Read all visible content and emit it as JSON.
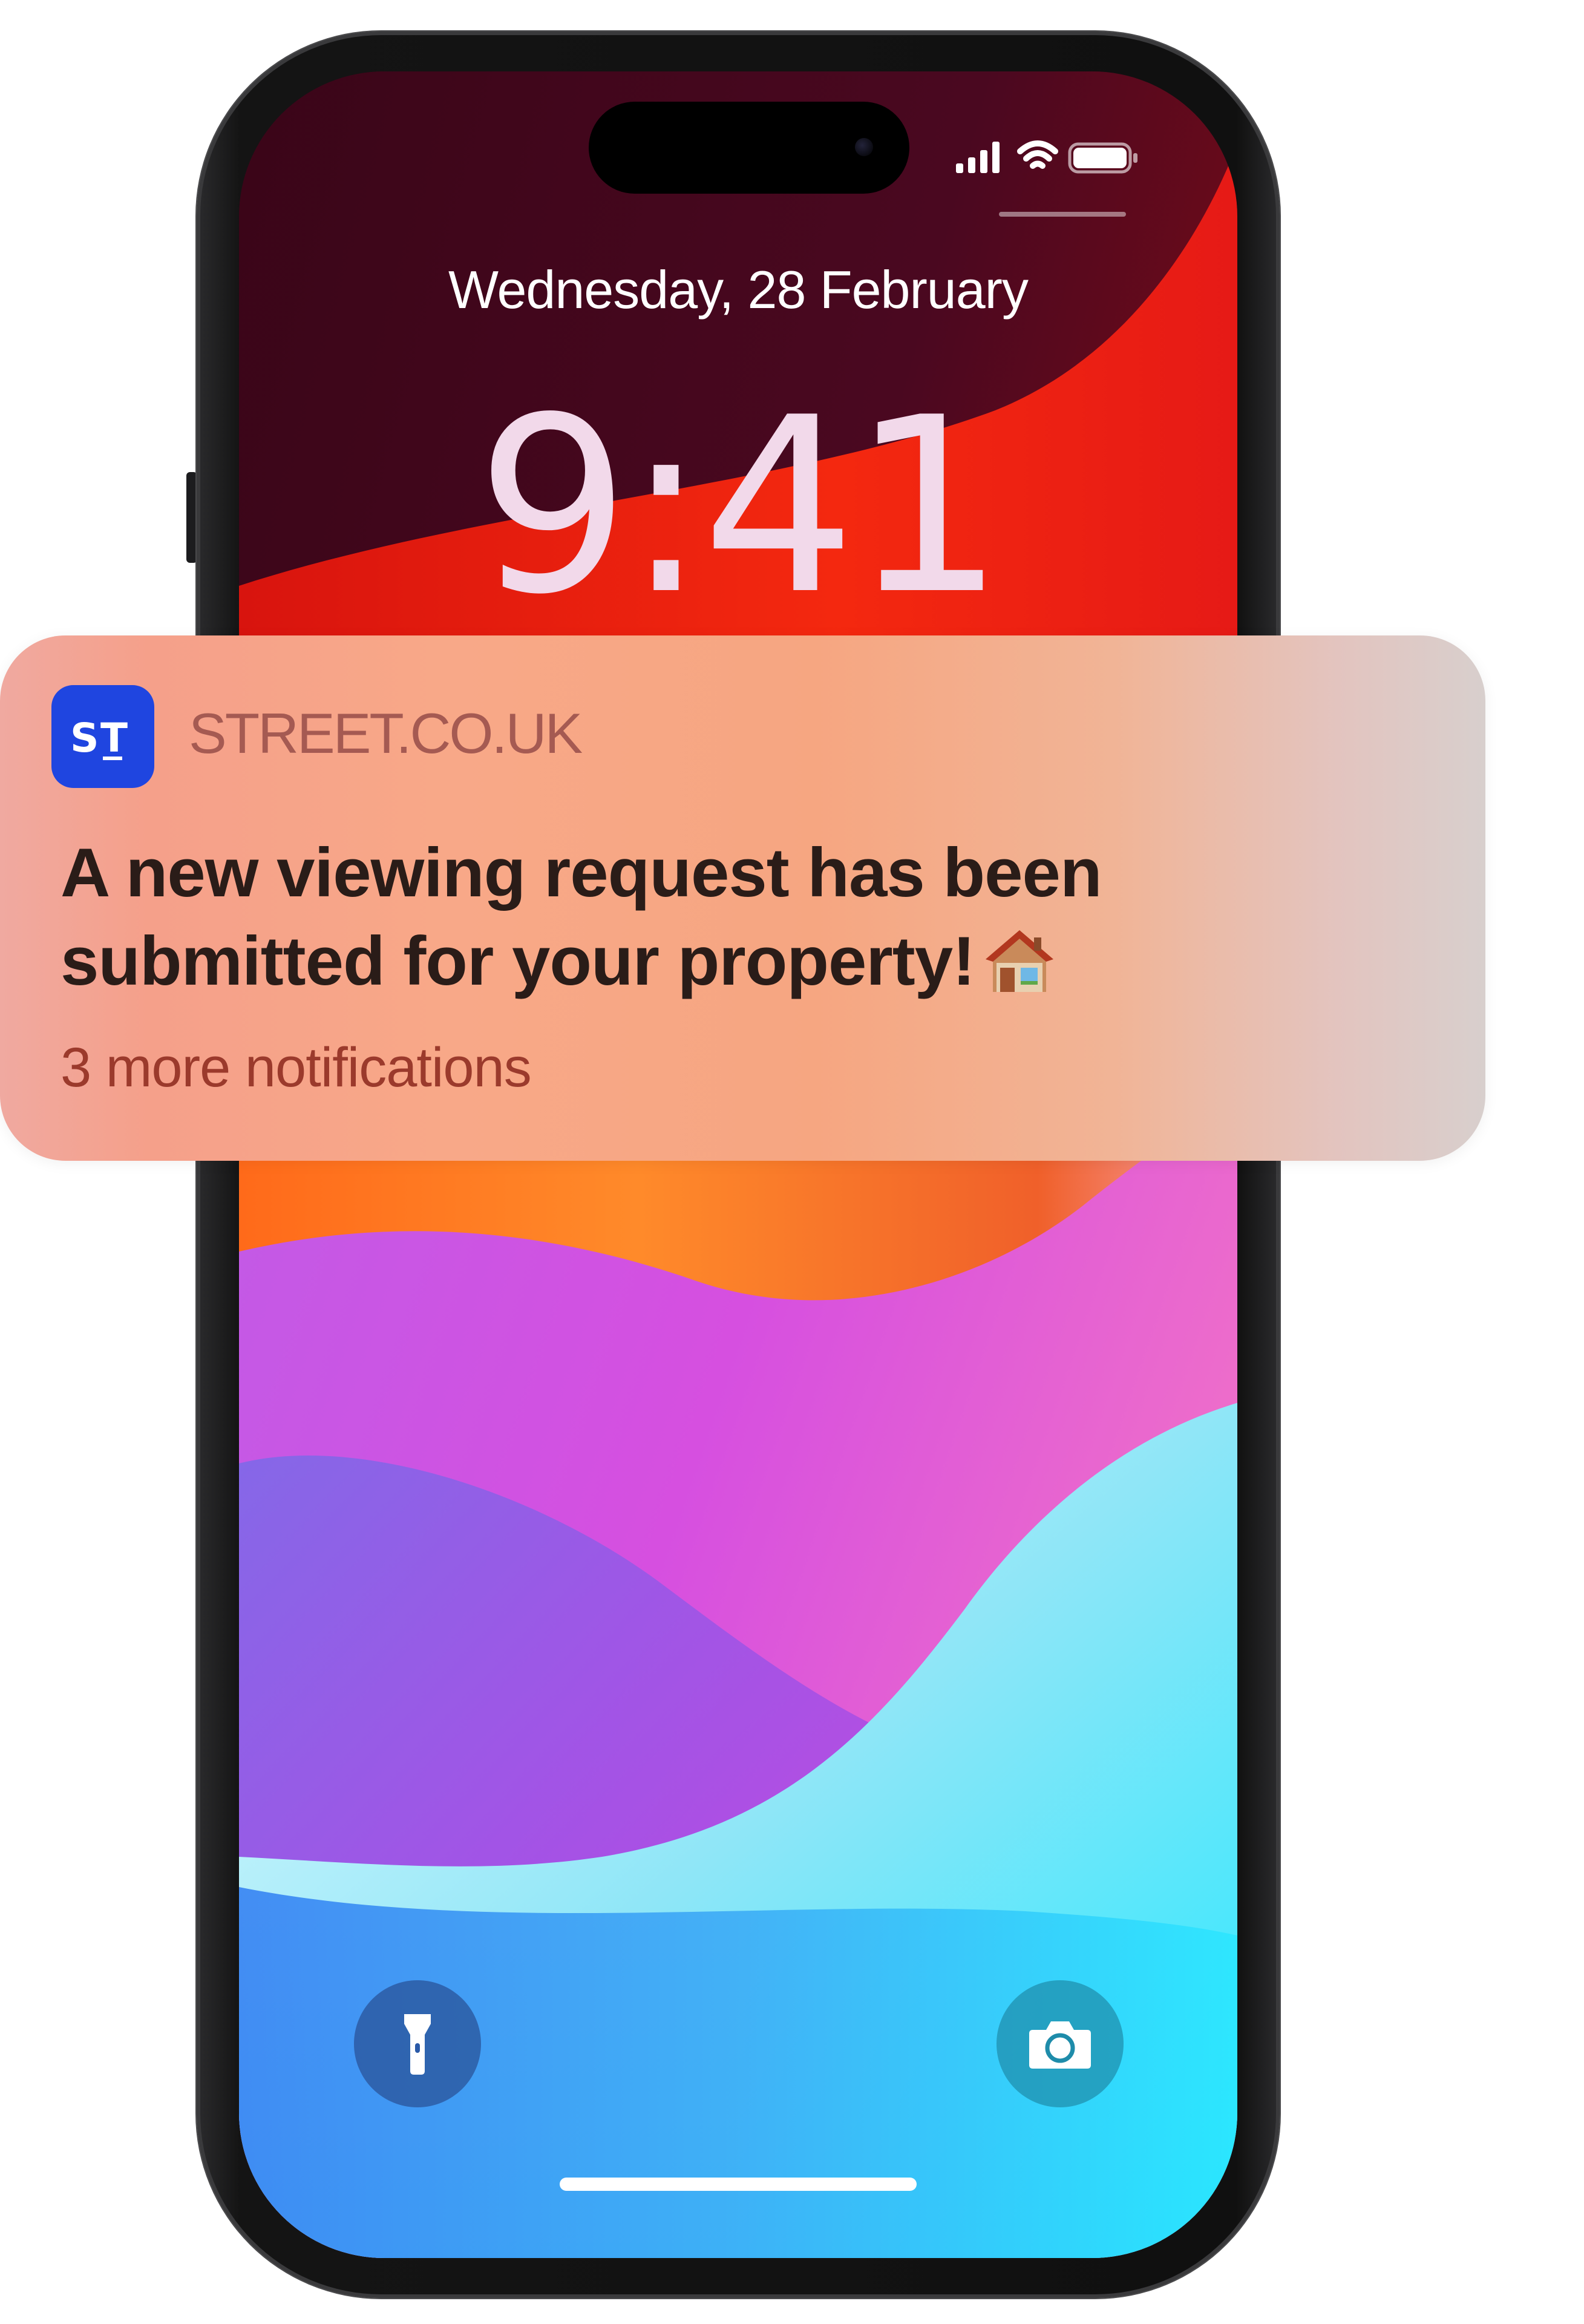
{
  "lock_screen": {
    "date": "Wednesday, 28 February",
    "time": "9:41"
  },
  "status_bar": {
    "icons": [
      "cellular-signal-icon",
      "wifi-icon",
      "battery-icon"
    ]
  },
  "notification": {
    "app_icon_text": "ST",
    "app_name": "STREET.CO.UK",
    "message": "A new viewing request has been submitted for your property!",
    "emoji_icon": "house-icon",
    "more_text": "3 more notifications"
  },
  "quick_actions": {
    "left_icon": "flashlight-icon",
    "right_icon": "camera-icon"
  },
  "colors": {
    "app_icon_bg": "#1f45e0",
    "app_name": "#a55a52",
    "message": "#2a1c18",
    "more_text": "#9b3a2c"
  }
}
